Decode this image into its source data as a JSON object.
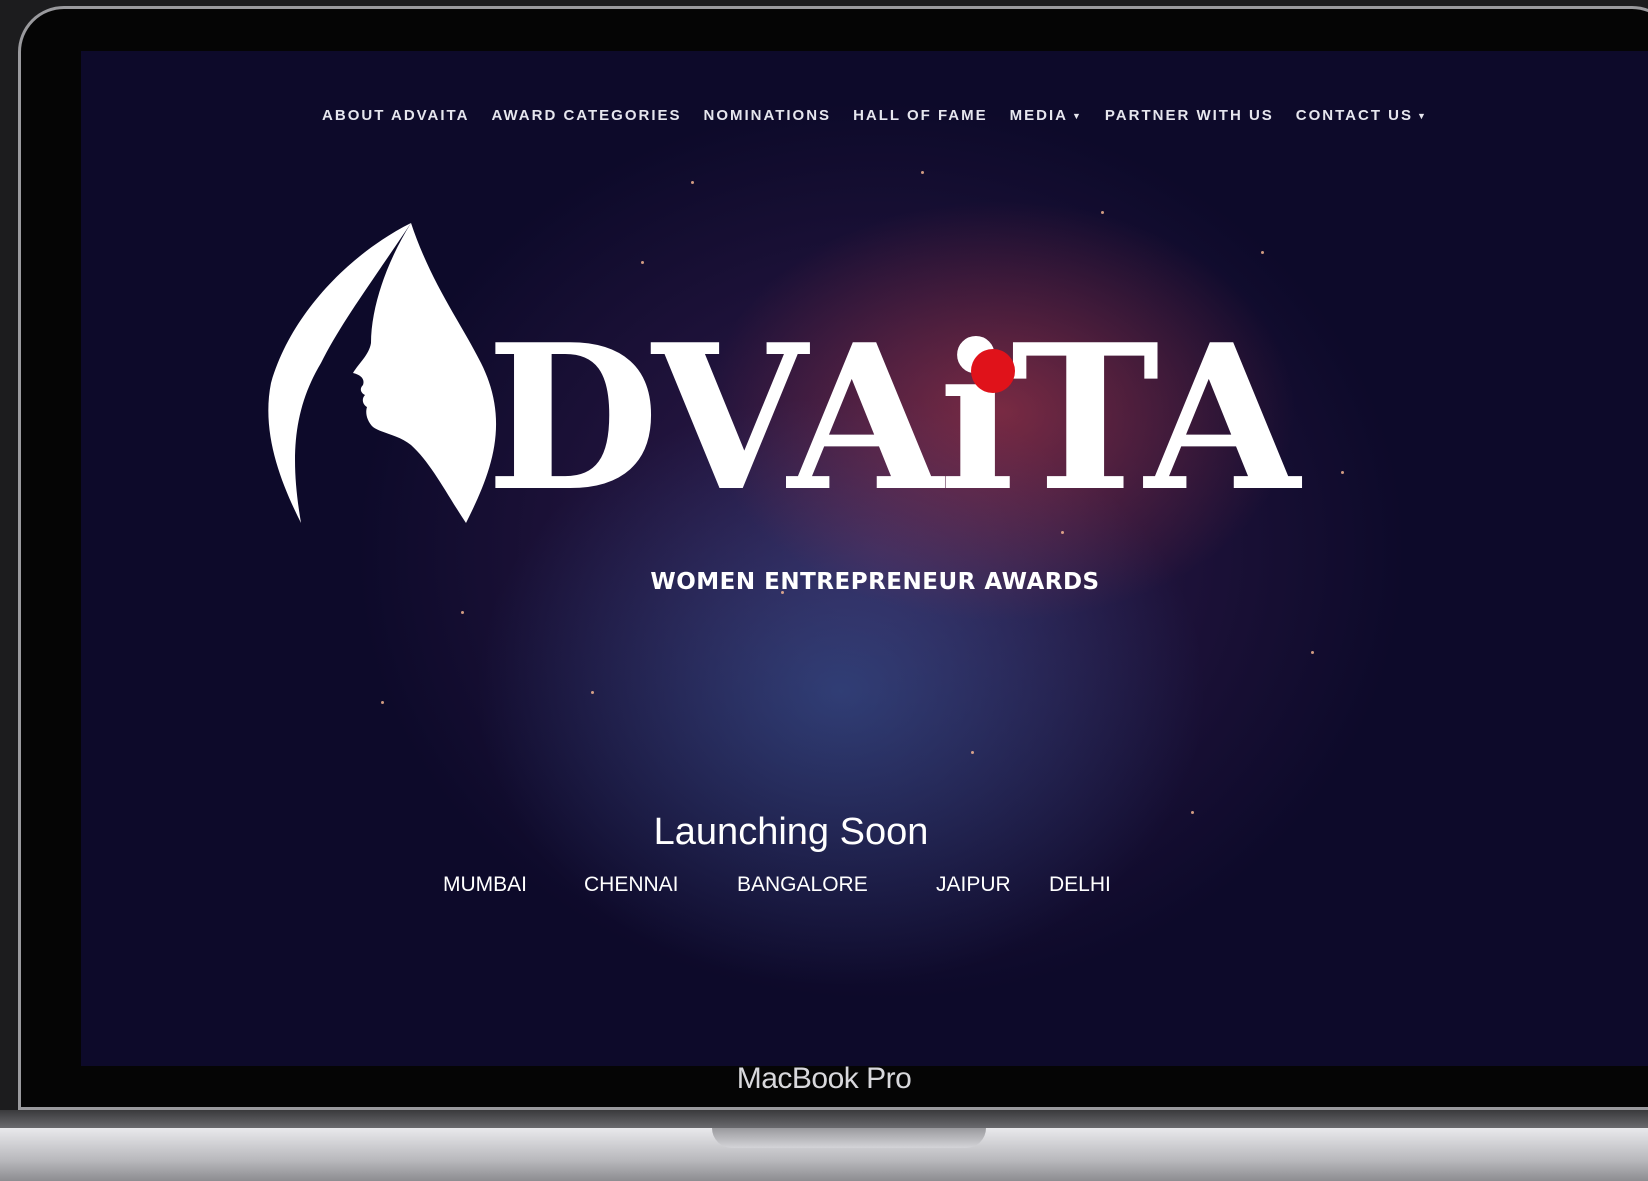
{
  "nav": {
    "items": [
      {
        "label": "ABOUT ADVAITA",
        "dropdown": false
      },
      {
        "label": "AWARD CATEGORIES",
        "dropdown": false
      },
      {
        "label": "NOMINATIONS",
        "dropdown": false
      },
      {
        "label": "HALL OF FAME",
        "dropdown": false
      },
      {
        "label": "MEDIA",
        "dropdown": true
      },
      {
        "label": "PARTNER WITH US",
        "dropdown": false
      },
      {
        "label": "CONTACT US",
        "dropdown": true
      }
    ]
  },
  "hero": {
    "logo_text": "DVAiTA",
    "logo_accent_color": "#e0121a",
    "subtitle": "WOMEN ENTREPRENEUR AWARDS",
    "launch_heading": "Launching Soon",
    "cities": [
      "MUMBAI",
      "CHENNAI",
      "BANGALORE",
      "JAIPUR",
      "DELHI"
    ]
  },
  "device": {
    "brand_label": "MacBook Pro"
  },
  "colors": {
    "background": "#0d0a2a",
    "text": "#ffffff"
  }
}
